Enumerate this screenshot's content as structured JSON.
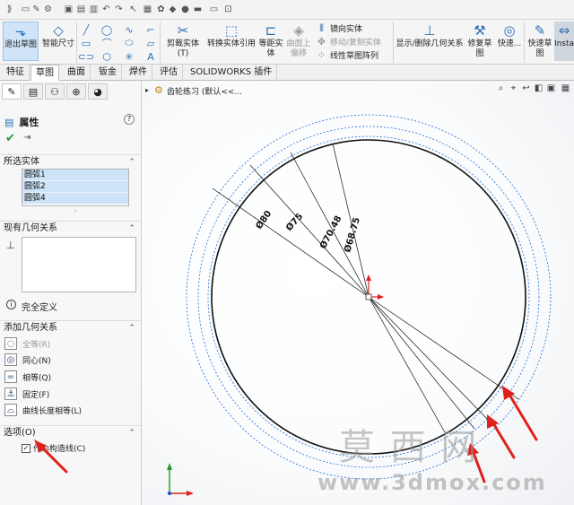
{
  "ribbon": {
    "exit_sketch": "退出草图",
    "smart_dimension": "智能尺寸",
    "trim_entities": "剪裁实体(T)",
    "convert_entities": "转换实体引用",
    "offset_entities": "等距实\n体",
    "offset_on_surface": "曲面上\n偏移",
    "mirror_entities": "镜向实体",
    "move_copy_entities": "移动/复制实体",
    "linear_sketch_pattern": "线性草图阵列",
    "display_delete_relations": "显示/删除几何关系",
    "repair_sketch": "修复草\n图",
    "quick_snaps": "快速...",
    "rapid_sketch": "快速草\n图",
    "instant2d": "Insta"
  },
  "tabs": [
    "特征",
    "草图",
    "曲面",
    "钣金",
    "焊件",
    "评估",
    "SOLIDWORKS 插件"
  ],
  "active_tab": "草图",
  "panel": {
    "title": "属性",
    "help": "?",
    "selected_entities": {
      "header": "所选实体",
      "items": [
        "圆弧1",
        "圆弧2",
        "圆弧4"
      ]
    },
    "existing_relations": {
      "header": "现有几何关系",
      "status": "完全定义"
    },
    "add_relations": {
      "header": "添加几何关系",
      "items": [
        {
          "label": "全等(R)",
          "icon": "coradial-icon",
          "dim": true
        },
        {
          "label": "同心(N)",
          "icon": "concentric-icon",
          "dim": false
        },
        {
          "label": "相等(Q)",
          "icon": "equal-icon",
          "dim": false
        },
        {
          "label": "固定(F)",
          "icon": "fix-icon",
          "dim": false
        },
        {
          "label": "曲线长度相等(L)",
          "icon": "equal-curve-length-icon",
          "dim": false
        }
      ]
    },
    "options": {
      "header": "选项(O)",
      "construction_label": "作为构造线(C)",
      "construction_checked": true
    }
  },
  "tree": {
    "part_name": "齿轮练习 (默认<<..."
  },
  "dimensions": [
    "Ø80",
    "Ø75",
    "Ø70.48",
    "Ø68.75"
  ],
  "watermark": {
    "cn": "莫 西 网",
    "url": "www.3dmox.com"
  },
  "colors": {
    "accent": "#2a6fb3",
    "arrow_red": "#e0211b",
    "construction": "#1a6fd6",
    "selection": "#cde3f7"
  }
}
